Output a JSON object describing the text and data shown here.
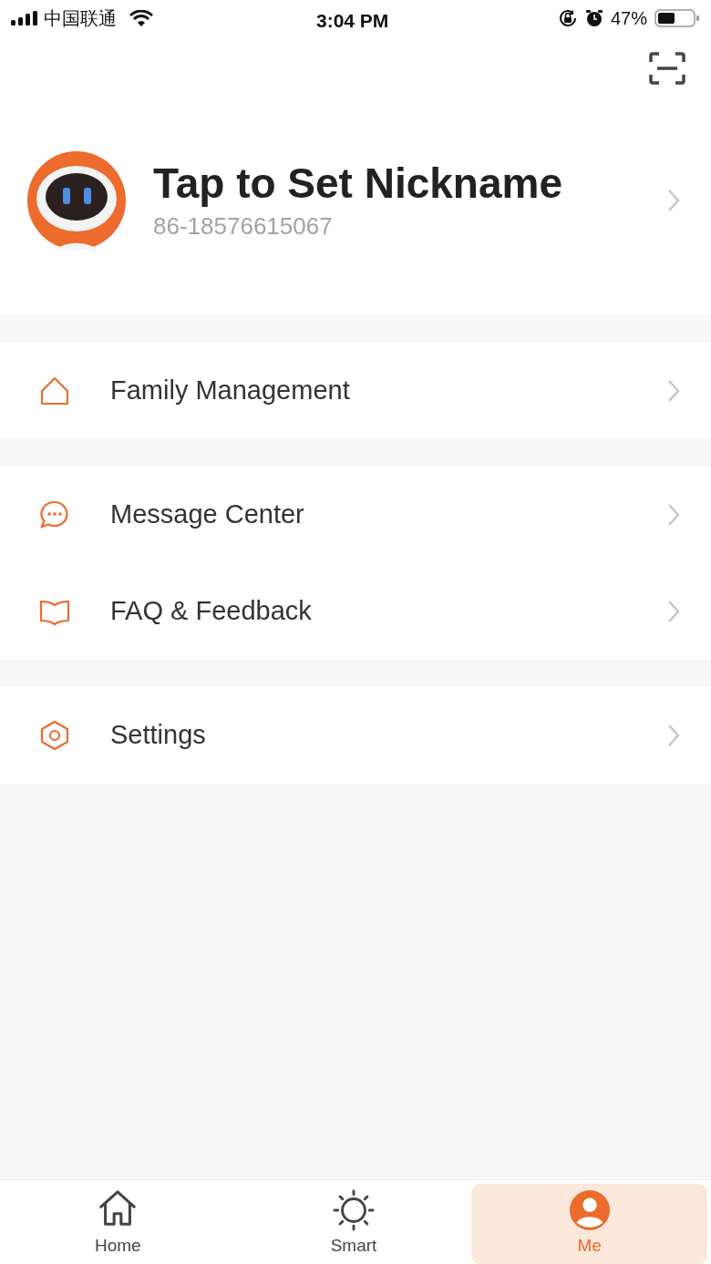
{
  "status_bar": {
    "carrier": "中国联通",
    "time": "3:04 PM",
    "battery": "47%"
  },
  "profile": {
    "nickname": "Tap to Set Nickname",
    "account": "86-18576615067"
  },
  "menu_groups": [
    [
      {
        "kind": "home",
        "label": "Family Management"
      }
    ],
    [
      {
        "kind": "message",
        "label": "Message Center"
      },
      {
        "kind": "book",
        "label": "FAQ & Feedback"
      }
    ],
    [
      {
        "kind": "settings",
        "label": "Settings"
      }
    ]
  ],
  "tabs": [
    {
      "kind": "home",
      "label": "Home",
      "selected": false
    },
    {
      "kind": "smart",
      "label": "Smart",
      "selected": false
    },
    {
      "kind": "me",
      "label": "Me",
      "selected": true
    }
  ]
}
